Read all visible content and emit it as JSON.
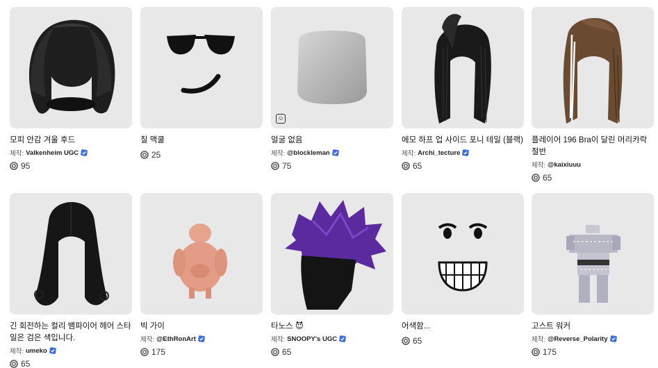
{
  "creator_prefix": "제작:",
  "items": [
    {
      "name": "모피 안감 겨울 후드",
      "creator": "Valkenheim UGC",
      "verified": true,
      "price": "95",
      "icon": "fur-winter-hood"
    },
    {
      "name": "칠 맥쿨",
      "creator": "",
      "verified": false,
      "price": "25",
      "icon": "sunglasses-smirk-face"
    },
    {
      "name": "얼굴 없음",
      "creator": "@blockleman",
      "verified": true,
      "price": "75",
      "icon": "blank-head",
      "ugc_badge": "☺"
    },
    {
      "name": "에모 하프 업 사이드 포니 테일 (블랙)",
      "creator": "Archi_tecture",
      "verified": true,
      "price": "65",
      "icon": "black-side-ponytail-hair"
    },
    {
      "name": "플레이어 196 Bra이 달린 머리카락 절반",
      "creator": "@kaixiuuu",
      "verified": false,
      "price": "65",
      "icon": "brown-braided-hair"
    },
    {
      "name": "긴 회전하는 컬리 뱀파이어 헤어 스타일은 검은 색입니다.",
      "creator": "umeko",
      "verified": true,
      "price": "65",
      "icon": "long-curly-black-hair"
    },
    {
      "name": "빅 가이",
      "creator": "@EthRonArt",
      "verified": true,
      "price": "175",
      "icon": "big-guy-body"
    },
    {
      "name": "타노스 😈",
      "creator": "SNOOPY's UGC",
      "verified": true,
      "price": "65",
      "icon": "purple-spiky-hair"
    },
    {
      "name": "어색함...",
      "creator": "",
      "verified": false,
      "price": "65",
      "icon": "awkward-grin-face"
    },
    {
      "name": "고스트 워커",
      "creator": "@Reverse_Polarity",
      "verified": true,
      "price": "175",
      "icon": "ghost-walker-body"
    }
  ]
}
